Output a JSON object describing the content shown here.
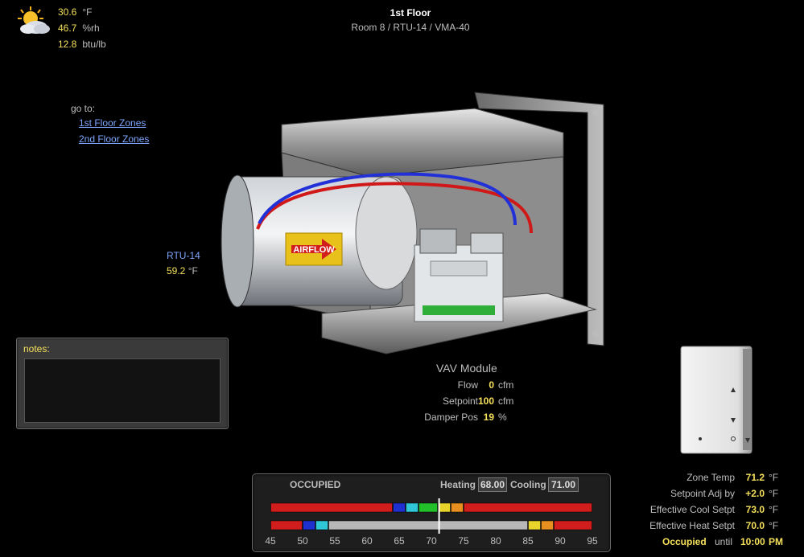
{
  "weather": {
    "icon": "partly-cloudy-icon",
    "temperature": {
      "value": "30.6",
      "unit": "°F"
    },
    "humidity": {
      "value": "46.7",
      "unit": "%rh"
    },
    "enthalpy": {
      "value": "12.8",
      "unit": "btu/lb"
    }
  },
  "header": {
    "title": "1st Floor",
    "subtitle": "Room 8 / RTU-14 / VMA-40"
  },
  "goto": {
    "label": "go to:",
    "links": [
      "1st Floor Zones",
      "2nd Floor Zones"
    ]
  },
  "rtu": {
    "name": "RTU-14",
    "temp_value": "59.2",
    "temp_unit": "°F"
  },
  "image": {
    "label_airflow": "AIRFLOW"
  },
  "notes": {
    "label": "notes:",
    "content": ""
  },
  "vav": {
    "title": "VAV Module",
    "flow": {
      "label": "Flow",
      "value": "0",
      "unit": "cfm"
    },
    "setpoint": {
      "label": "Setpoint",
      "value": "100",
      "unit": "cfm"
    },
    "damper": {
      "label": "Damper Pos",
      "value": "19",
      "unit": "%"
    }
  },
  "zone": {
    "zone_temp": {
      "label": "Zone Temp",
      "value": "71.2",
      "unit": "°F"
    },
    "setpoint_adj": {
      "label": "Setpoint Adj by",
      "value": "+2.0",
      "unit": "°F"
    },
    "eff_cool": {
      "label": "Effective Cool Setpt",
      "value": "73.0",
      "unit": "°F"
    },
    "eff_heat": {
      "label": "Effective Heat Setpt",
      "value": "70.0",
      "unit": "°F"
    },
    "occupied": {
      "label": "Occupied",
      "until": "until",
      "time": "10:00",
      "ampm": "PM"
    }
  },
  "schedule": {
    "mode": "OCCUPIED",
    "heating_label": "Heating",
    "heating_value": "68.00",
    "cooling_label": "Cooling",
    "cooling_value": "71.00",
    "scale": {
      "min": 45,
      "max": 95,
      "ticks": [
        45,
        50,
        55,
        60,
        65,
        70,
        75,
        80,
        85,
        90,
        95
      ]
    },
    "current_temp": 71.2,
    "occupied_bands": [
      {
        "from": 45,
        "to": 64,
        "color": "#d21d1d"
      },
      {
        "from": 64,
        "to": 66,
        "color": "#1f2fd0"
      },
      {
        "from": 66,
        "to": 68,
        "color": "#2ec8d8"
      },
      {
        "from": 68,
        "to": 71,
        "color": "#22c02a"
      },
      {
        "from": 71,
        "to": 73,
        "color": "#e8d42a"
      },
      {
        "from": 73,
        "to": 75,
        "color": "#e8901f"
      },
      {
        "from": 75,
        "to": 95,
        "color": "#d21d1d"
      }
    ],
    "unoccupied_bands": [
      {
        "from": 45,
        "to": 50,
        "color": "#d21d1d"
      },
      {
        "from": 50,
        "to": 52,
        "color": "#1f2fd0"
      },
      {
        "from": 52,
        "to": 54,
        "color": "#2ec8d8"
      },
      {
        "from": 54,
        "to": 85,
        "color": "#b8b8b8"
      },
      {
        "from": 85,
        "to": 87,
        "color": "#e8d42a"
      },
      {
        "from": 87,
        "to": 89,
        "color": "#e8901f"
      },
      {
        "from": 89,
        "to": 95,
        "color": "#d21d1d"
      }
    ]
  }
}
